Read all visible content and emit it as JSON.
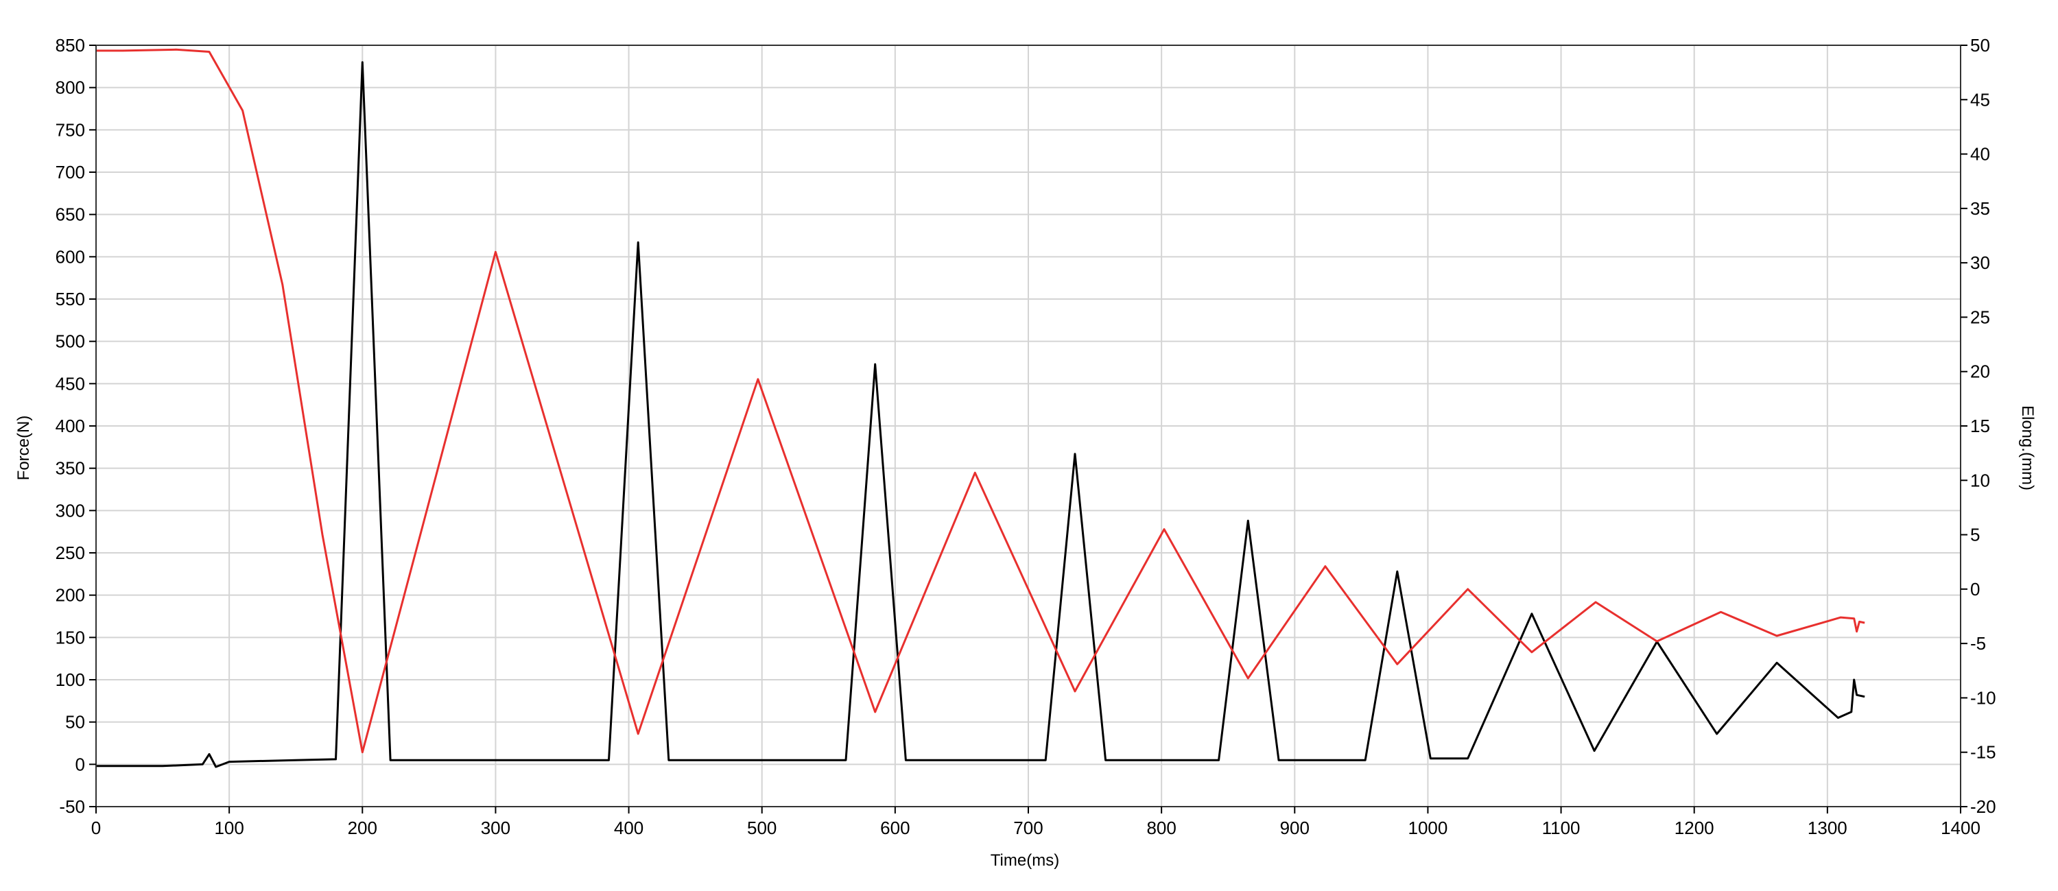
{
  "chart_data": {
    "type": "line",
    "xlabel": "Time(ms)",
    "ylabel_left": "Force(N)",
    "ylabel_right": "Elong.(mm)",
    "xlim": [
      0,
      1400
    ],
    "ylim_left": [
      -50,
      850
    ],
    "ylim_right": [
      -20,
      50
    ],
    "x_ticks": [
      0,
      100,
      200,
      300,
      400,
      500,
      600,
      700,
      800,
      900,
      1000,
      1100,
      1200,
      1300,
      1400
    ],
    "y_left_ticks": [
      -50,
      0,
      50,
      100,
      150,
      200,
      250,
      300,
      350,
      400,
      450,
      500,
      550,
      600,
      650,
      700,
      750,
      800,
      850
    ],
    "y_right_ticks": [
      -20,
      -15,
      -10,
      -5,
      0,
      5,
      10,
      15,
      20,
      25,
      30,
      35,
      40,
      45,
      50
    ],
    "grid": true,
    "legend": "none",
    "series": [
      {
        "axis": "left",
        "color": "#000000",
        "points": [
          [
            0,
            -2
          ],
          [
            50,
            -2
          ],
          [
            80,
            0
          ],
          [
            85,
            12
          ],
          [
            90,
            -3
          ],
          [
            100,
            3
          ],
          [
            150,
            5
          ],
          [
            180,
            6
          ],
          [
            200,
            830
          ],
          [
            221,
            5
          ],
          [
            300,
            5
          ],
          [
            385,
            5
          ],
          [
            407,
            617
          ],
          [
            430,
            5
          ],
          [
            500,
            5
          ],
          [
            563,
            5
          ],
          [
            585,
            473
          ],
          [
            608,
            5
          ],
          [
            700,
            5
          ],
          [
            713,
            5
          ],
          [
            735,
            367
          ],
          [
            758,
            5
          ],
          [
            800,
            5
          ],
          [
            843,
            5
          ],
          [
            865,
            288
          ],
          [
            888,
            5
          ],
          [
            900,
            5
          ],
          [
            953,
            5
          ],
          [
            977,
            228
          ],
          [
            1002,
            7
          ],
          [
            1030,
            7
          ],
          [
            1078,
            178
          ],
          [
            1125,
            16
          ],
          [
            1172,
            145
          ],
          [
            1217,
            36
          ],
          [
            1262,
            120
          ],
          [
            1308,
            55
          ],
          [
            1318,
            62
          ],
          [
            1320,
            100
          ],
          [
            1322,
            82
          ],
          [
            1328,
            80
          ]
        ]
      },
      {
        "axis": "right",
        "color": "#e8302e",
        "points": [
          [
            0,
            49.5
          ],
          [
            20,
            49.5
          ],
          [
            60,
            49.6
          ],
          [
            85,
            49.4
          ],
          [
            110,
            44
          ],
          [
            140,
            28
          ],
          [
            170,
            5
          ],
          [
            200,
            -15
          ],
          [
            300,
            31
          ],
          [
            407,
            -13.3
          ],
          [
            497,
            19.3
          ],
          [
            585,
            -11.3
          ],
          [
            660,
            10.7
          ],
          [
            735,
            -9.4
          ],
          [
            802,
            5.5
          ],
          [
            865,
            -8.2
          ],
          [
            923,
            2.1
          ],
          [
            977,
            -6.9
          ],
          [
            1030,
            0
          ],
          [
            1078,
            -5.8
          ],
          [
            1126,
            -1.2
          ],
          [
            1172,
            -4.8
          ],
          [
            1220,
            -2.1
          ],
          [
            1262,
            -4.3
          ],
          [
            1310,
            -2.6
          ],
          [
            1320,
            -2.7
          ],
          [
            1322,
            -3.9
          ],
          [
            1324,
            -3.0
          ],
          [
            1328,
            -3.1
          ]
        ]
      }
    ]
  }
}
